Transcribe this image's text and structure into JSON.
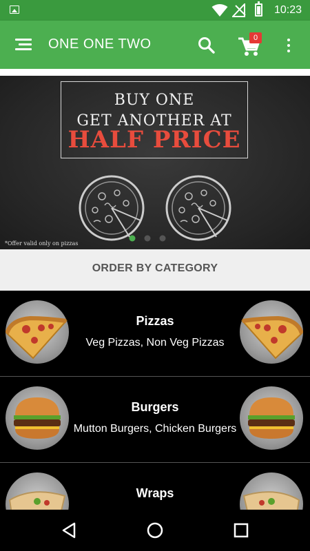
{
  "status_bar": {
    "time": "10:23",
    "icons": [
      "image-icon",
      "wifi-icon",
      "no-signal-icon",
      "battery-icon"
    ]
  },
  "app_bar": {
    "title": "ONE ONE TWO",
    "cart_count": "0",
    "icons": [
      "menu-icon",
      "search-icon",
      "cart-icon",
      "more-vert-icon"
    ],
    "color": "#4caf50"
  },
  "banner": {
    "line1": "BUY ONE",
    "line2": "GET ANOTHER AT",
    "line3": "HALF PRICE",
    "note": "*Offer valid only on pizzas",
    "accent_color": "#e84c3d",
    "active_slide": 1,
    "slide_count": 3
  },
  "category_header": "ORDER BY CATEGORY",
  "categories": [
    {
      "name": "Pizzas",
      "subtitle": "Veg Pizzas, Non Veg Pizzas",
      "icon": "pizza-slice-icon"
    },
    {
      "name": "Burgers",
      "subtitle": "Mutton Burgers, Chicken Burgers",
      "icon": "burger-icon"
    },
    {
      "name": "Wraps",
      "subtitle": "",
      "icon": "wrap-icon"
    }
  ],
  "nav_bar": {
    "icons": [
      "back-icon",
      "home-icon",
      "recents-icon"
    ]
  }
}
